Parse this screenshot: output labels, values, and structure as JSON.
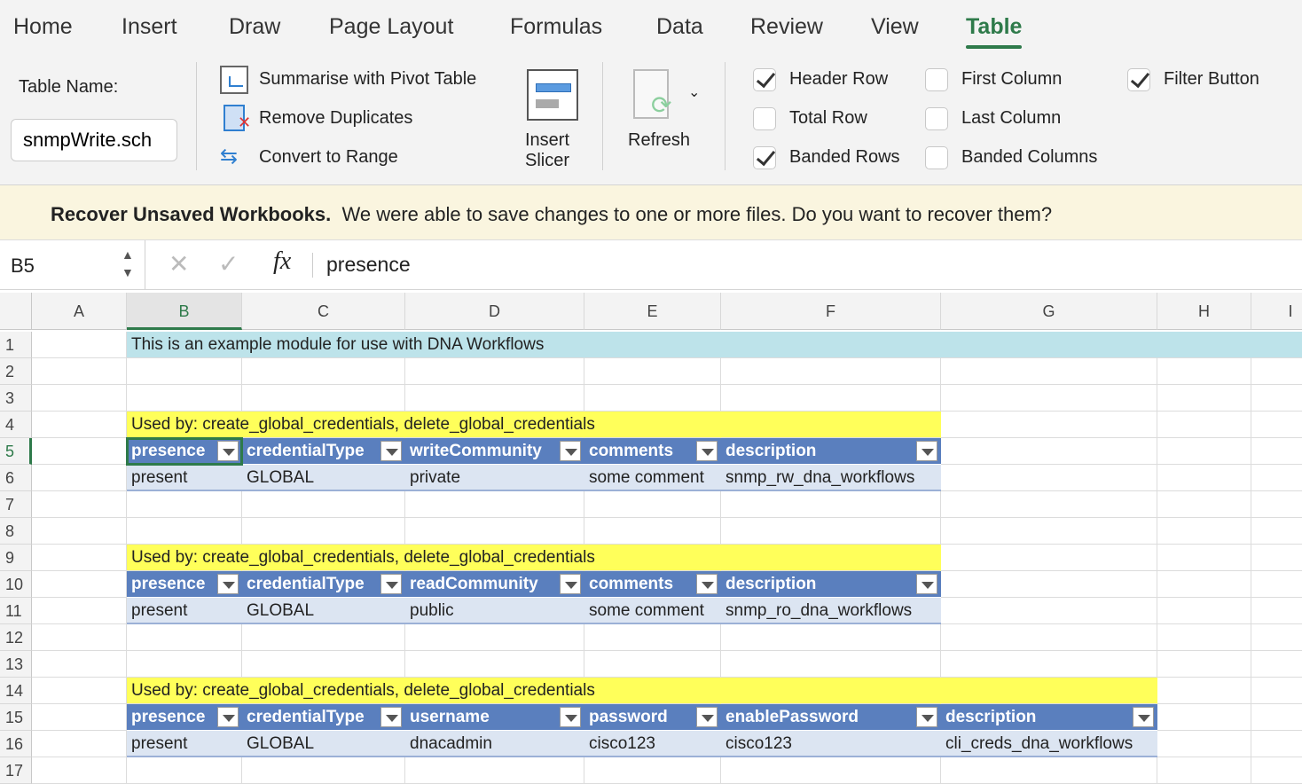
{
  "ribbon": {
    "tabs": [
      "Home",
      "Insert",
      "Draw",
      "Page Layout",
      "Formulas",
      "Data",
      "Review",
      "View",
      "Table"
    ],
    "active_tab": "Table",
    "table_name_label": "Table Name:",
    "table_name_value": "snmpWrite.sch",
    "tools": [
      "Summarise with Pivot Table",
      "Remove Duplicates",
      "Convert to Range"
    ],
    "insert_slicer": "Insert\nSlicer",
    "refresh": "Refresh",
    "options": [
      {
        "label": "Header Row",
        "checked": true
      },
      {
        "label": "Total Row",
        "checked": false
      },
      {
        "label": "Banded Rows",
        "checked": true
      },
      {
        "label": "First Column",
        "checked": false
      },
      {
        "label": "Last Column",
        "checked": false
      },
      {
        "label": "Banded Columns",
        "checked": false
      },
      {
        "label": "Filter Button",
        "checked": true
      }
    ]
  },
  "banner": {
    "title": "Recover Unsaved Workbooks.",
    "message": "We were able to save changes to one or more files. Do you want to recover them?"
  },
  "formula_bar": {
    "cell_ref": "B5",
    "formula": "presence"
  },
  "sheet": {
    "columns": [
      "A",
      "B",
      "C",
      "D",
      "E",
      "F",
      "G",
      "H",
      "I"
    ],
    "selected_column": "B",
    "selected_row": 5,
    "rows": [
      {
        "n": 1,
        "style": "info",
        "span": "B-I",
        "cells": {
          "B": "This is an example module for use with DNA Workflows"
        }
      },
      {
        "n": 2
      },
      {
        "n": 3
      },
      {
        "n": 4,
        "style": "note",
        "span": "B-F",
        "cells": {
          "B": "Used by: create_global_credentials, delete_global_credentials"
        }
      },
      {
        "n": 5,
        "style": "hdr",
        "cells": {
          "B": "presence",
          "C": "credentialType",
          "D": "writeCommunity",
          "E": "comments",
          "F": "description"
        }
      },
      {
        "n": 6,
        "style": "dat",
        "cells": {
          "B": "present",
          "C": "GLOBAL",
          "D": "private",
          "E": "some comment",
          "F": "snmp_rw_dna_workflows"
        }
      },
      {
        "n": 7
      },
      {
        "n": 8
      },
      {
        "n": 9,
        "style": "note",
        "span": "B-F",
        "cells": {
          "B": "Used by: create_global_credentials, delete_global_credentials"
        }
      },
      {
        "n": 10,
        "style": "hdr",
        "cells": {
          "B": "presence",
          "C": "credentialType",
          "D": "readCommunity",
          "E": "comments",
          "F": "description"
        }
      },
      {
        "n": 11,
        "style": "dat",
        "cells": {
          "B": "present",
          "C": "GLOBAL",
          "D": "public",
          "E": "some comment",
          "F": "snmp_ro_dna_workflows"
        }
      },
      {
        "n": 12
      },
      {
        "n": 13
      },
      {
        "n": 14,
        "style": "note",
        "span": "B-G",
        "cells": {
          "B": "Used by: create_global_credentials, delete_global_credentials"
        }
      },
      {
        "n": 15,
        "style": "hdr",
        "cells": {
          "B": "presence",
          "C": "credentialType",
          "D": "username",
          "E": "password",
          "F": "enablePassword",
          "G": "description"
        }
      },
      {
        "n": 16,
        "style": "dat",
        "cells": {
          "B": "present",
          "C": "GLOBAL",
          "D": "dnacadmin",
          "E": "cisco123",
          "F": "cisco123",
          "G": "cli_creds_dna_workflows"
        }
      },
      {
        "n": 17
      }
    ]
  },
  "colors": {
    "accent": "#2e7a4a",
    "table_header": "#5a7fbe",
    "table_band": "#dce5f2",
    "note": "#ffff5a",
    "info": "#bde3ea"
  }
}
